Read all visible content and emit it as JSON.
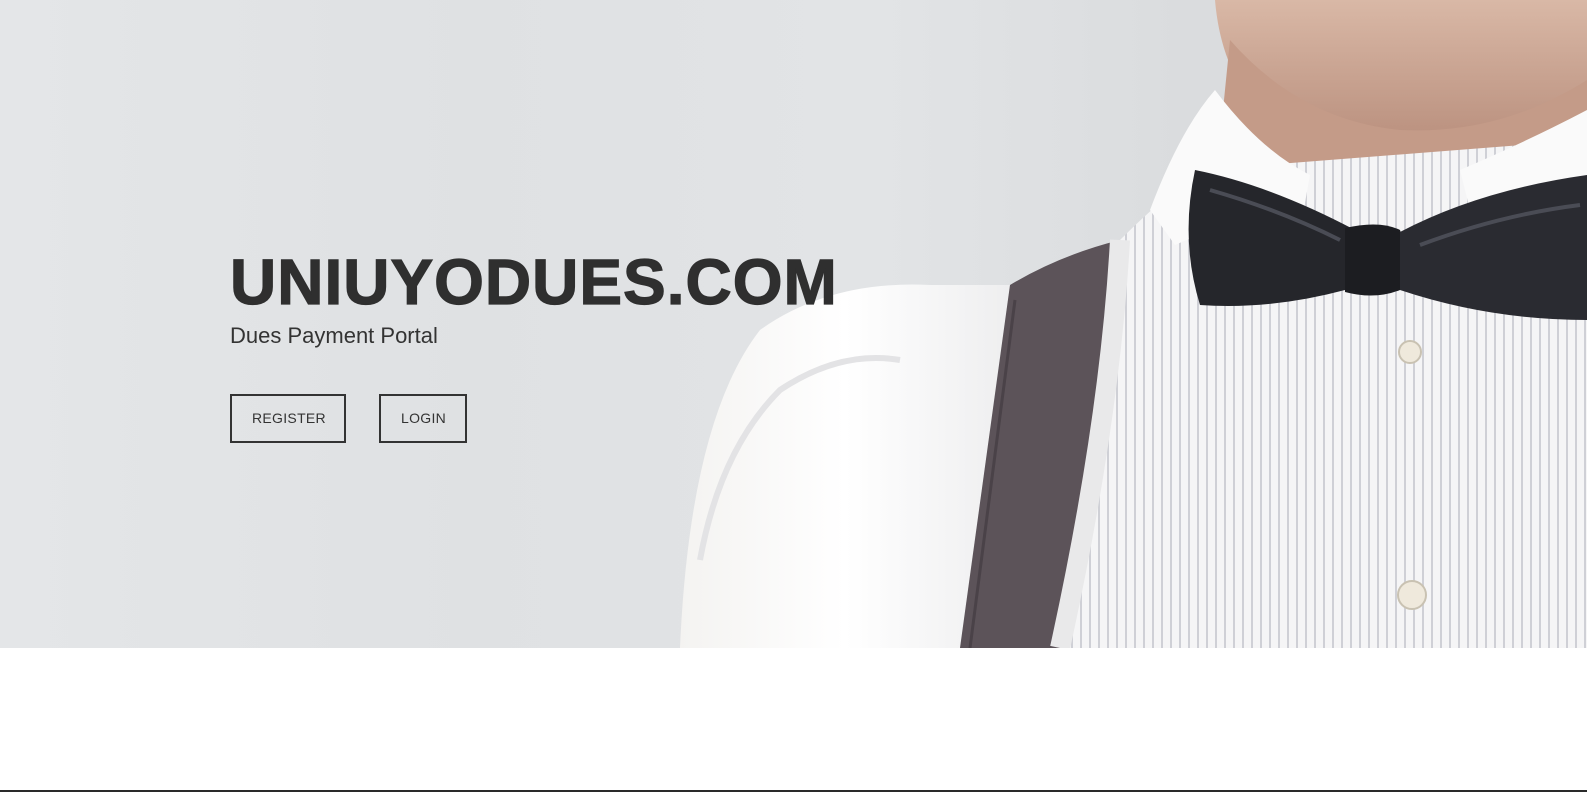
{
  "hero": {
    "title": "UNIUYODUES.COM",
    "subtitle": "Dues Payment Portal",
    "image_description_icon": "man-bowtie-photo",
    "buttons": {
      "register_label": "REGISTER",
      "login_label": "LOGIN"
    }
  },
  "colors": {
    "text_dark": "#2f2f2f",
    "hero_background": "#e2e4e6",
    "page_background": "#ffffff"
  }
}
